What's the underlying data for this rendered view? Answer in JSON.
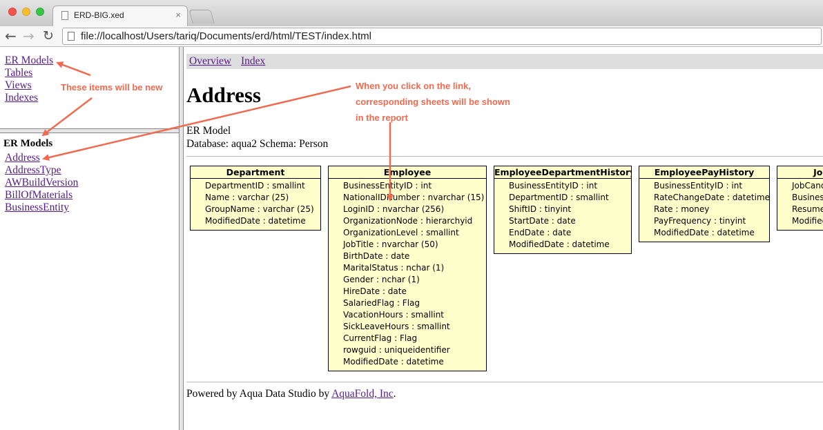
{
  "browser": {
    "tab_title": "ERD-BIG.xed",
    "tab_close": "×",
    "url": "file://localhost/Users/tariq/Documents/erd/html/TEST/index.html",
    "back_icon": "←",
    "forward_icon": "→",
    "reload_icon": "↻"
  },
  "left_top_nav": [
    {
      "label": "ER Models"
    },
    {
      "label": "Tables"
    },
    {
      "label": "Views"
    },
    {
      "label": "Indexes"
    }
  ],
  "left_bottom": {
    "heading": "ER Models",
    "items": [
      {
        "label": "Address"
      },
      {
        "label": "AddressType"
      },
      {
        "label": "AWBuildVersion"
      },
      {
        "label": "BillOfMaterials"
      },
      {
        "label": "BusinessEntity"
      }
    ]
  },
  "main": {
    "nav": {
      "overview": "Overview",
      "index": "Index"
    },
    "title": "Address",
    "subtitle": "ER Model",
    "database_line": "Database: aqua2 Schema: Person",
    "footer_prefix": "Powered by Aqua Data Studio by ",
    "footer_link": "AquaFold, Inc",
    "footer_suffix": "."
  },
  "entities": [
    {
      "name": "Department",
      "columns": [
        "DepartmentID : smallint",
        "Name : varchar (25)",
        "GroupName : varchar (25)",
        "ModifiedDate : datetime"
      ]
    },
    {
      "name": "Employee",
      "columns": [
        "BusinessEntityID : int",
        "NationalIDNumber : nvarchar (15)",
        "LoginID : nvarchar (256)",
        "OrganizationNode : hierarchyid",
        "OrganizationLevel : smallint",
        "JobTitle : nvarchar (50)",
        "BirthDate : date",
        "MaritalStatus : nchar (1)",
        "Gender : nchar (1)",
        "HireDate : date",
        "SalariedFlag : Flag",
        "VacationHours : smallint",
        "SickLeaveHours : smallint",
        "CurrentFlag : Flag",
        "rowguid : uniqueidentifier",
        "ModifiedDate : datetime"
      ]
    },
    {
      "name": "EmployeeDepartmentHistory",
      "columns": [
        "BusinessEntityID : int",
        "DepartmentID : smallint",
        "ShiftID : tinyint",
        "StartDate : date",
        "EndDate : date",
        "ModifiedDate : datetime"
      ]
    },
    {
      "name": "EmployeePayHistory",
      "columns": [
        "BusinessEntityID : int",
        "RateChangeDate : datetime",
        "Rate : money",
        "PayFrequency : tinyint",
        "ModifiedDate : datetime"
      ]
    },
    {
      "name": "JobCandidate",
      "columns": [
        "JobCandidateID : int",
        "BusinessEntityID : int",
        "Resume : xml",
        "ModifiedDate : datetime"
      ]
    }
  ],
  "annotations": {
    "new_items": "These items will be new",
    "click_line1": "When you click on the link,",
    "click_line2": "corresponding sheets will be shown",
    "click_line3": "in the report",
    "color": "#f06a4f"
  }
}
